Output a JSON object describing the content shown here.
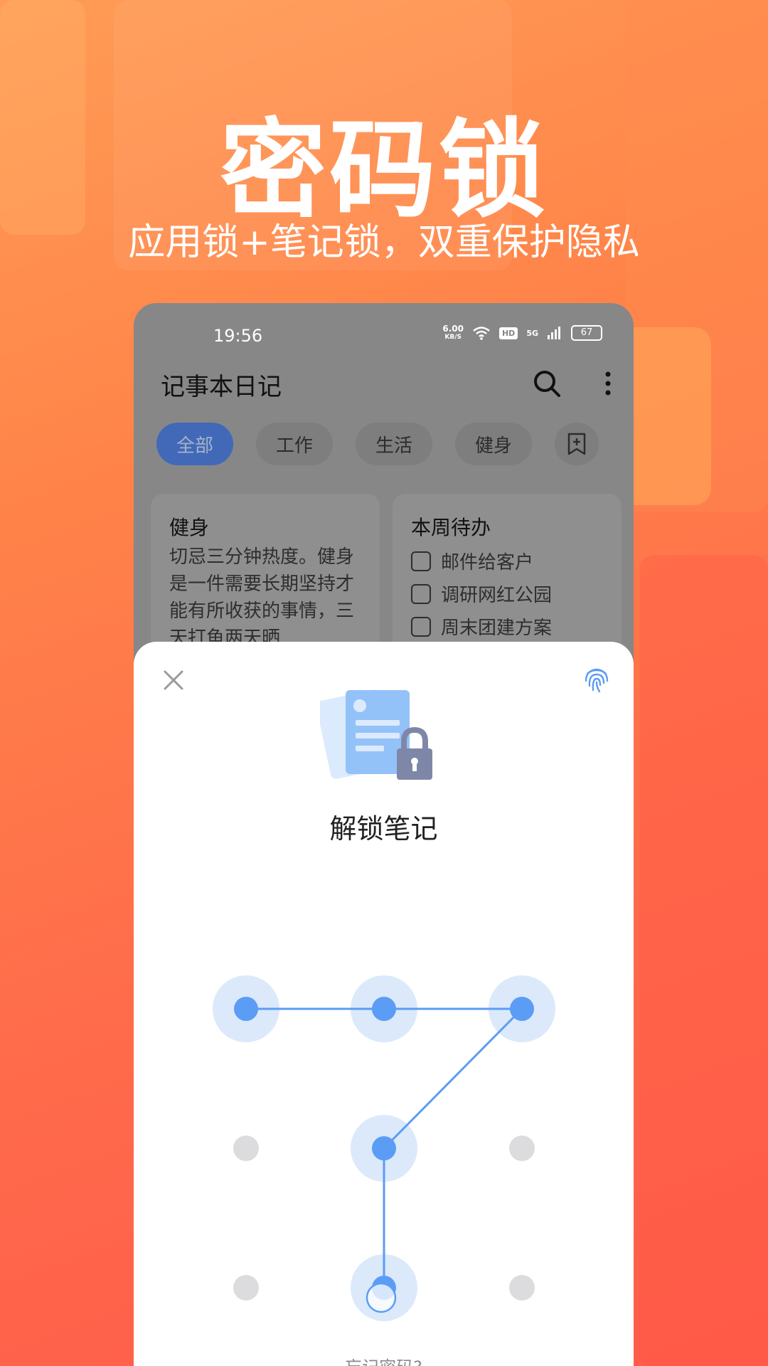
{
  "promo": {
    "title": "密码锁",
    "subtitle": "应用锁+笔记锁，双重保护隐私"
  },
  "status_bar": {
    "time": "19:56",
    "net_speed_value": "6.00",
    "net_speed_unit": "KB/S",
    "hd_badge": "HD",
    "network_type": "5G",
    "battery_level": "67"
  },
  "app_header": {
    "title": "记事本日记",
    "search_icon": "search-icon",
    "more_icon": "more-vertical-icon"
  },
  "tabs": [
    {
      "label": "全部",
      "active": true
    },
    {
      "label": "工作",
      "active": false
    },
    {
      "label": "生活",
      "active": false
    },
    {
      "label": "健身",
      "active": false
    }
  ],
  "tab_add_icon": "bookmark-add-icon",
  "notes": {
    "fitness_card": {
      "title": "健身",
      "body": "切忌三分钟热度。健身是一件需要长期坚持才能有所收获的事情，三天打鱼两天晒"
    },
    "todo_card": {
      "title": "本周待办",
      "items": [
        "邮件给客户",
        "调研网红公园",
        "周末团建方案"
      ]
    }
  },
  "unlock_sheet": {
    "close_icon": "close-icon",
    "fingerprint_icon": "fingerprint-icon",
    "illustration": "locked-note-icon",
    "title": "解锁笔记",
    "forgot_password": "忘记密码?"
  },
  "colors": {
    "accent_blue": "#5b9cf5",
    "ring_blue": "#dbe9fb",
    "dot_gray": "#dcdcde",
    "promo_orange": "#ff7a4a"
  },
  "pattern": {
    "grid": [
      3,
      3
    ],
    "selected_sequence": [
      1,
      2,
      3,
      5,
      8
    ]
  }
}
